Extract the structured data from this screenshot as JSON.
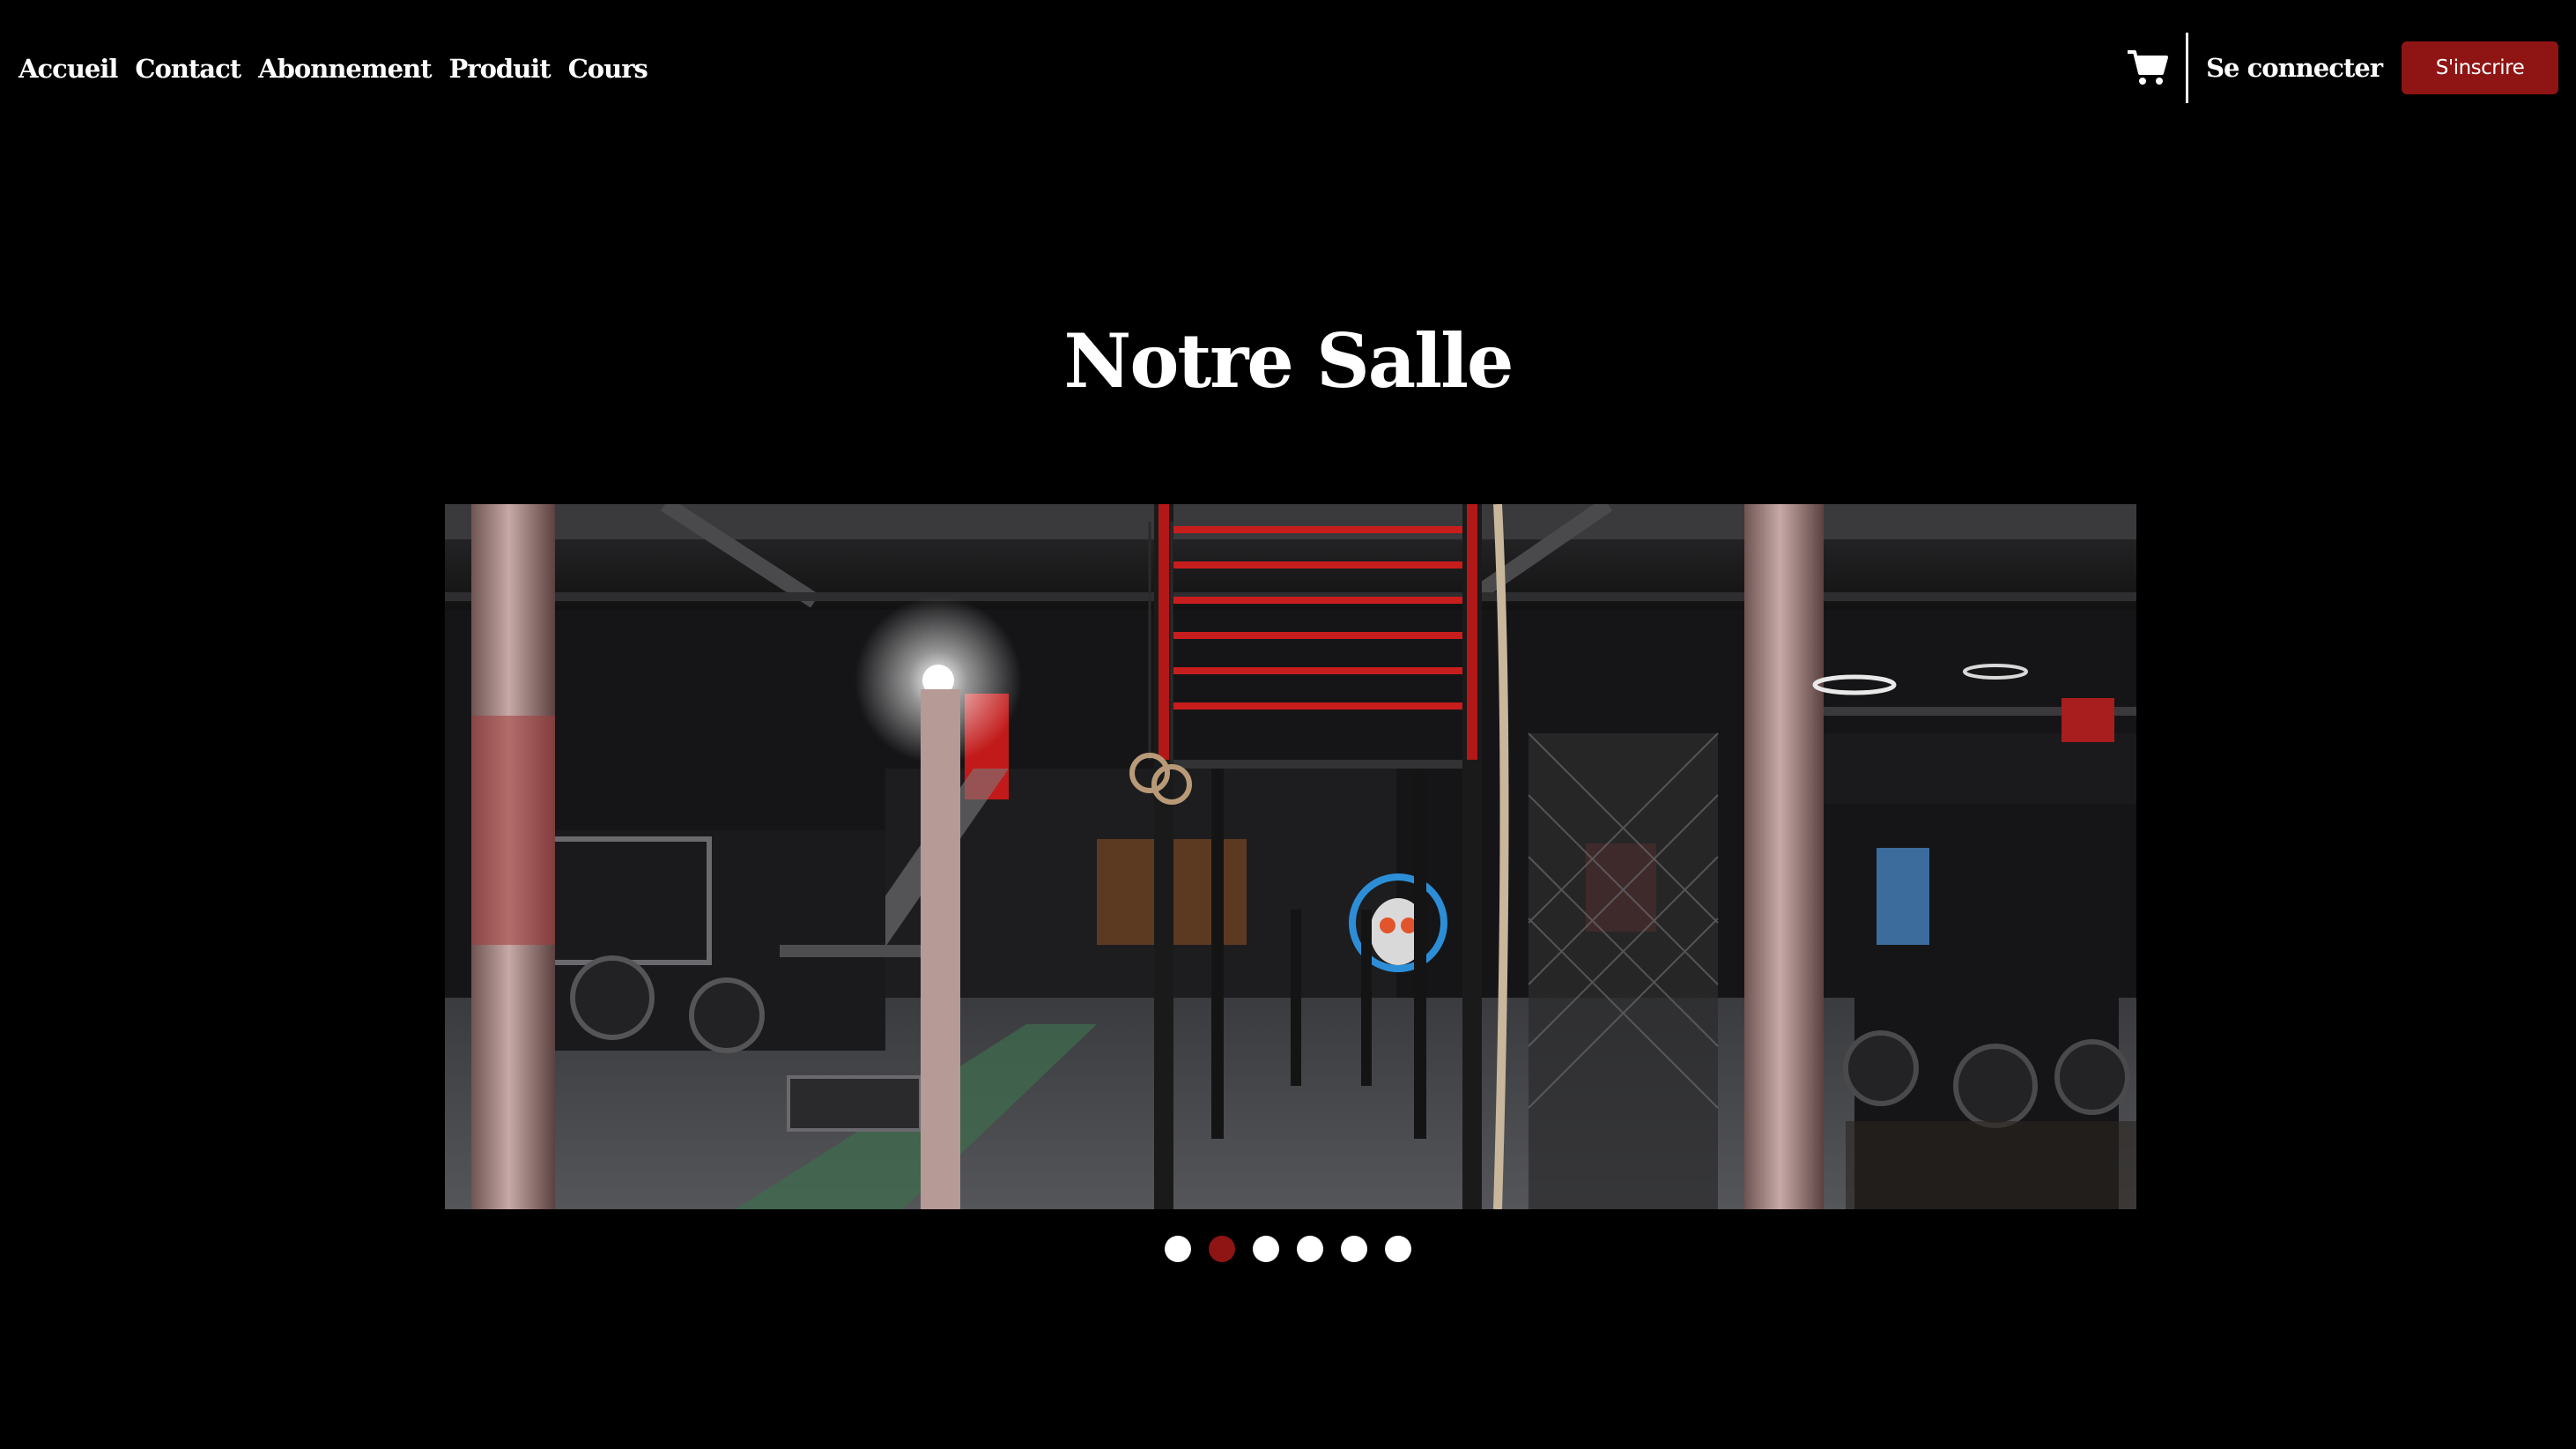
{
  "nav": {
    "links": [
      {
        "label": "Accueil"
      },
      {
        "label": "Contact"
      },
      {
        "label": "Abonnement"
      },
      {
        "label": "Produit"
      },
      {
        "label": "Cours"
      }
    ],
    "cart_icon": "shopping-cart-icon",
    "login_label": "Se connecter",
    "signup_label": "S'inscrire"
  },
  "main": {
    "title": "Notre Salle",
    "slideshow": {
      "slide_count": 6,
      "active_index": 1
    }
  },
  "colors": {
    "background": "#000000",
    "accent": "#8f1414",
    "text": "#ffffff"
  }
}
